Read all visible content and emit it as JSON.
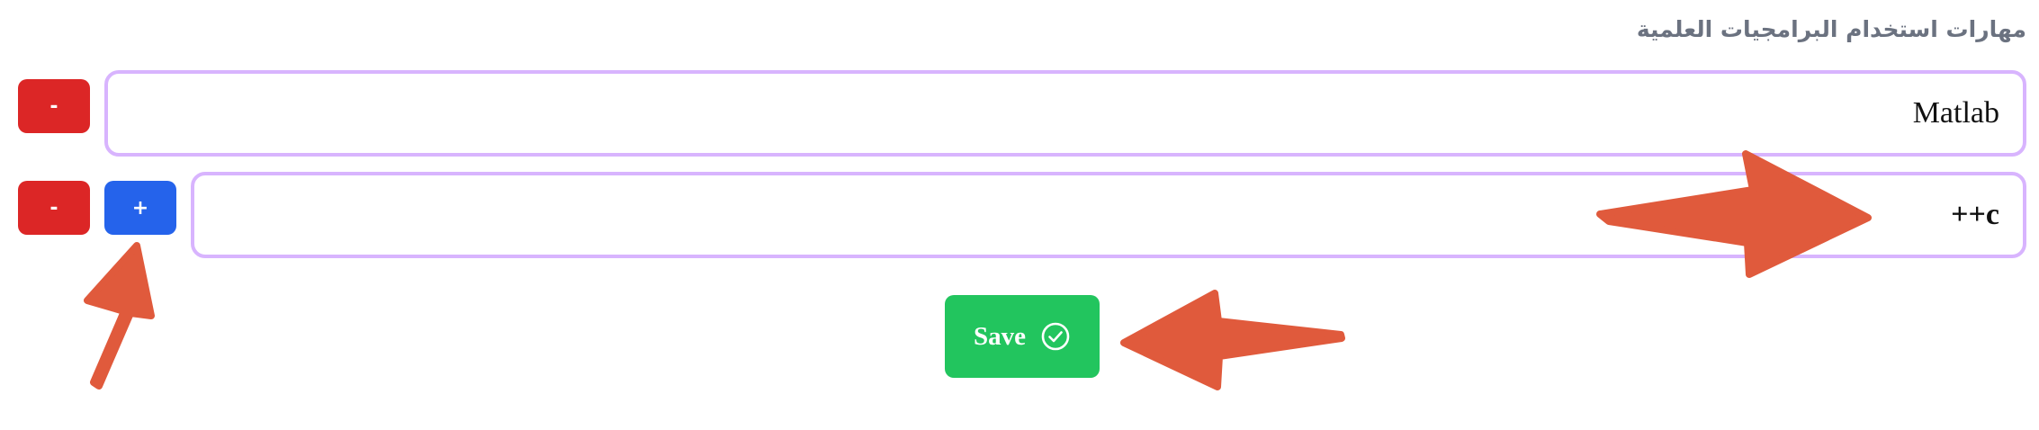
{
  "section": {
    "title": "مهارات استخدام البرامجيات العلمية"
  },
  "skills": [
    {
      "value": "Matlab",
      "remove_label": "-"
    },
    {
      "value": "++c",
      "remove_label": "-",
      "add_label": "+"
    }
  ],
  "save": {
    "label": "Save",
    "icon": "check-circle-icon"
  },
  "colors": {
    "remove": "#dc2626",
    "add": "#2563eb",
    "save": "#22c55e",
    "input_border": "#d8b4fe",
    "annotation_arrow": "#e05a3c"
  }
}
